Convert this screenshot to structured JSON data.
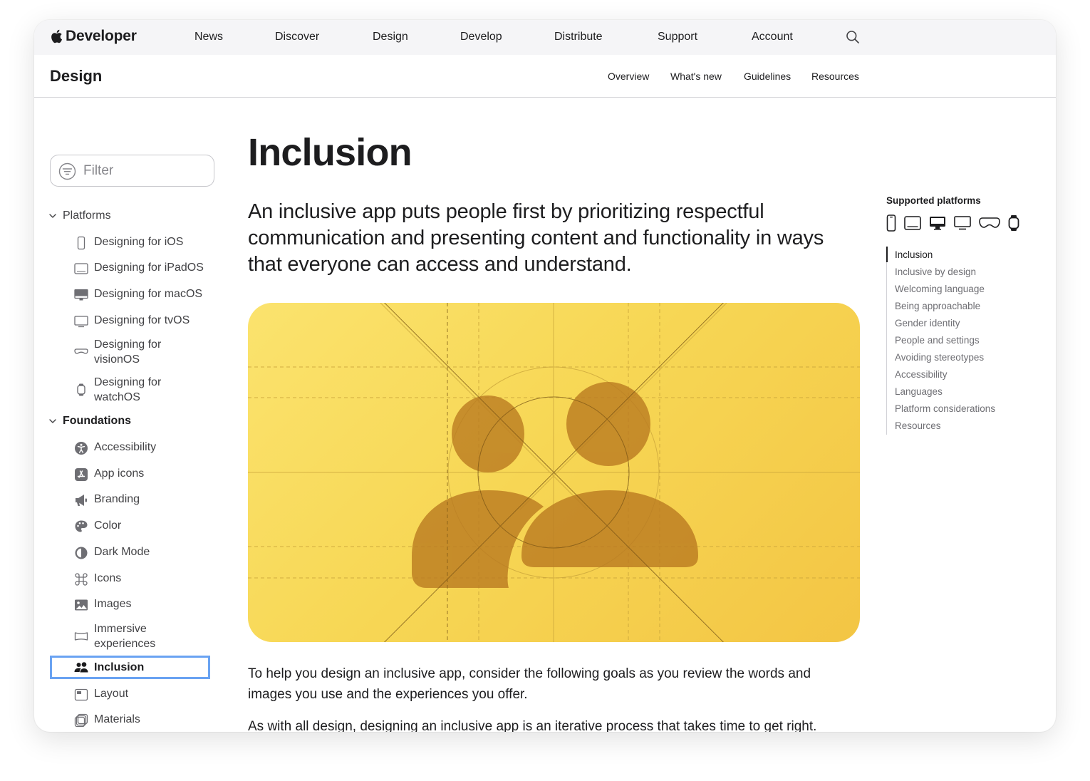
{
  "globalnav": {
    "brand": "Developer",
    "items": [
      "News",
      "Discover",
      "Design",
      "Develop",
      "Distribute",
      "Support",
      "Account"
    ]
  },
  "localnav": {
    "title": "Design",
    "items": [
      "Overview",
      "What's new",
      "Guidelines",
      "Resources"
    ]
  },
  "sidebar": {
    "filter_placeholder": "Filter",
    "groups": [
      {
        "label": "Platforms",
        "items": [
          {
            "label": "Designing for iOS",
            "icon": "iphone-icon"
          },
          {
            "label": "Designing for iPadOS",
            "icon": "ipad-icon"
          },
          {
            "label": "Designing for macOS",
            "icon": "mac-icon"
          },
          {
            "label": "Designing for tvOS",
            "icon": "tv-icon"
          },
          {
            "label": "Designing for visionOS",
            "icon": "vision-pro-icon"
          },
          {
            "label": "Designing for watchOS",
            "icon": "watch-icon"
          }
        ]
      },
      {
        "label": "Foundations",
        "items": [
          {
            "label": "Accessibility",
            "icon": "accessibility-icon"
          },
          {
            "label": "App icons",
            "icon": "app-store-icon"
          },
          {
            "label": "Branding",
            "icon": "megaphone-icon"
          },
          {
            "label": "Color",
            "icon": "palette-icon"
          },
          {
            "label": "Dark Mode",
            "icon": "half-circle-icon"
          },
          {
            "label": "Icons",
            "icon": "command-icon"
          },
          {
            "label": "Images",
            "icon": "photo-icon"
          },
          {
            "label": "Immersive experiences",
            "icon": "panorama-icon"
          },
          {
            "label": "Inclusion",
            "icon": "people-icon",
            "selected": true
          },
          {
            "label": "Layout",
            "icon": "layout-icon"
          },
          {
            "label": "Materials",
            "icon": "layers-icon"
          }
        ]
      }
    ]
  },
  "main": {
    "title": "Inclusion",
    "intro": "An inclusive app puts people first by prioritizing respectful communication and presenting content and functionality in ways that everyone can access and understand.",
    "hero_icon": "people-icon",
    "paragraphs": [
      "To help you design an inclusive app, consider the following goals as you review the words and images you use and the experiences you offer.",
      "As with all design, designing an inclusive app is an iterative process that takes time to get right."
    ]
  },
  "rightrail": {
    "supported_title": "Supported platforms",
    "platform_icons": [
      "iphone-icon",
      "ipad-icon",
      "mac-icon",
      "tv-icon",
      "vision-pro-icon",
      "watch-icon"
    ],
    "toc": [
      "Inclusion",
      "Inclusive by design",
      "Welcoming language",
      "Being approachable",
      "Gender identity",
      "People and settings",
      "Avoiding stereotypes",
      "Accessibility",
      "Languages",
      "Platform considerations",
      "Resources"
    ]
  },
  "colors": {
    "text": "#1d1d1f",
    "secondary_text": "#6e6e73",
    "nav_background": "#f5f5f7",
    "selection_outline": "#6aa3f2",
    "hero_gradient_start": "#fbe36e",
    "hero_gradient_end": "#f3c544",
    "hero_glyph": "#c48a2e"
  }
}
